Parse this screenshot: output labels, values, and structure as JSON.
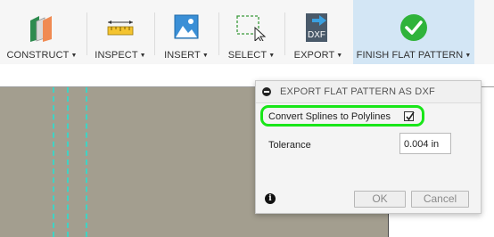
{
  "toolbar": {
    "items": [
      {
        "label": "CONSTRUCT",
        "icon": "construct-icon"
      },
      {
        "label": "INSPECT",
        "icon": "measure-ruler-icon"
      },
      {
        "label": "INSERT",
        "icon": "insert-image-icon"
      },
      {
        "label": "SELECT",
        "icon": "select-cursor-icon"
      },
      {
        "label": "EXPORT",
        "icon": "dxf-export-icon",
        "icon_text": "DXF"
      },
      {
        "label": "FINISH FLAT PATTERN",
        "icon": "finish-check-icon"
      }
    ],
    "caret": "▼"
  },
  "dialog": {
    "title": "EXPORT FLAT PATTERN AS DXF",
    "convert_label": "Convert Splines to Polylines",
    "convert_checked": true,
    "tolerance_label": "Tolerance",
    "tolerance_value": "0.004 in",
    "ok_label": "OK",
    "cancel_label": "Cancel",
    "info_glyph": "i"
  },
  "colors": {
    "accent_green": "#19e619",
    "finish_check": "#2fb33a",
    "flat_pattern_fill": "#a39e8f",
    "bend_line": "#3fd3c4",
    "active_tab_bg": "#d3e6f5"
  }
}
